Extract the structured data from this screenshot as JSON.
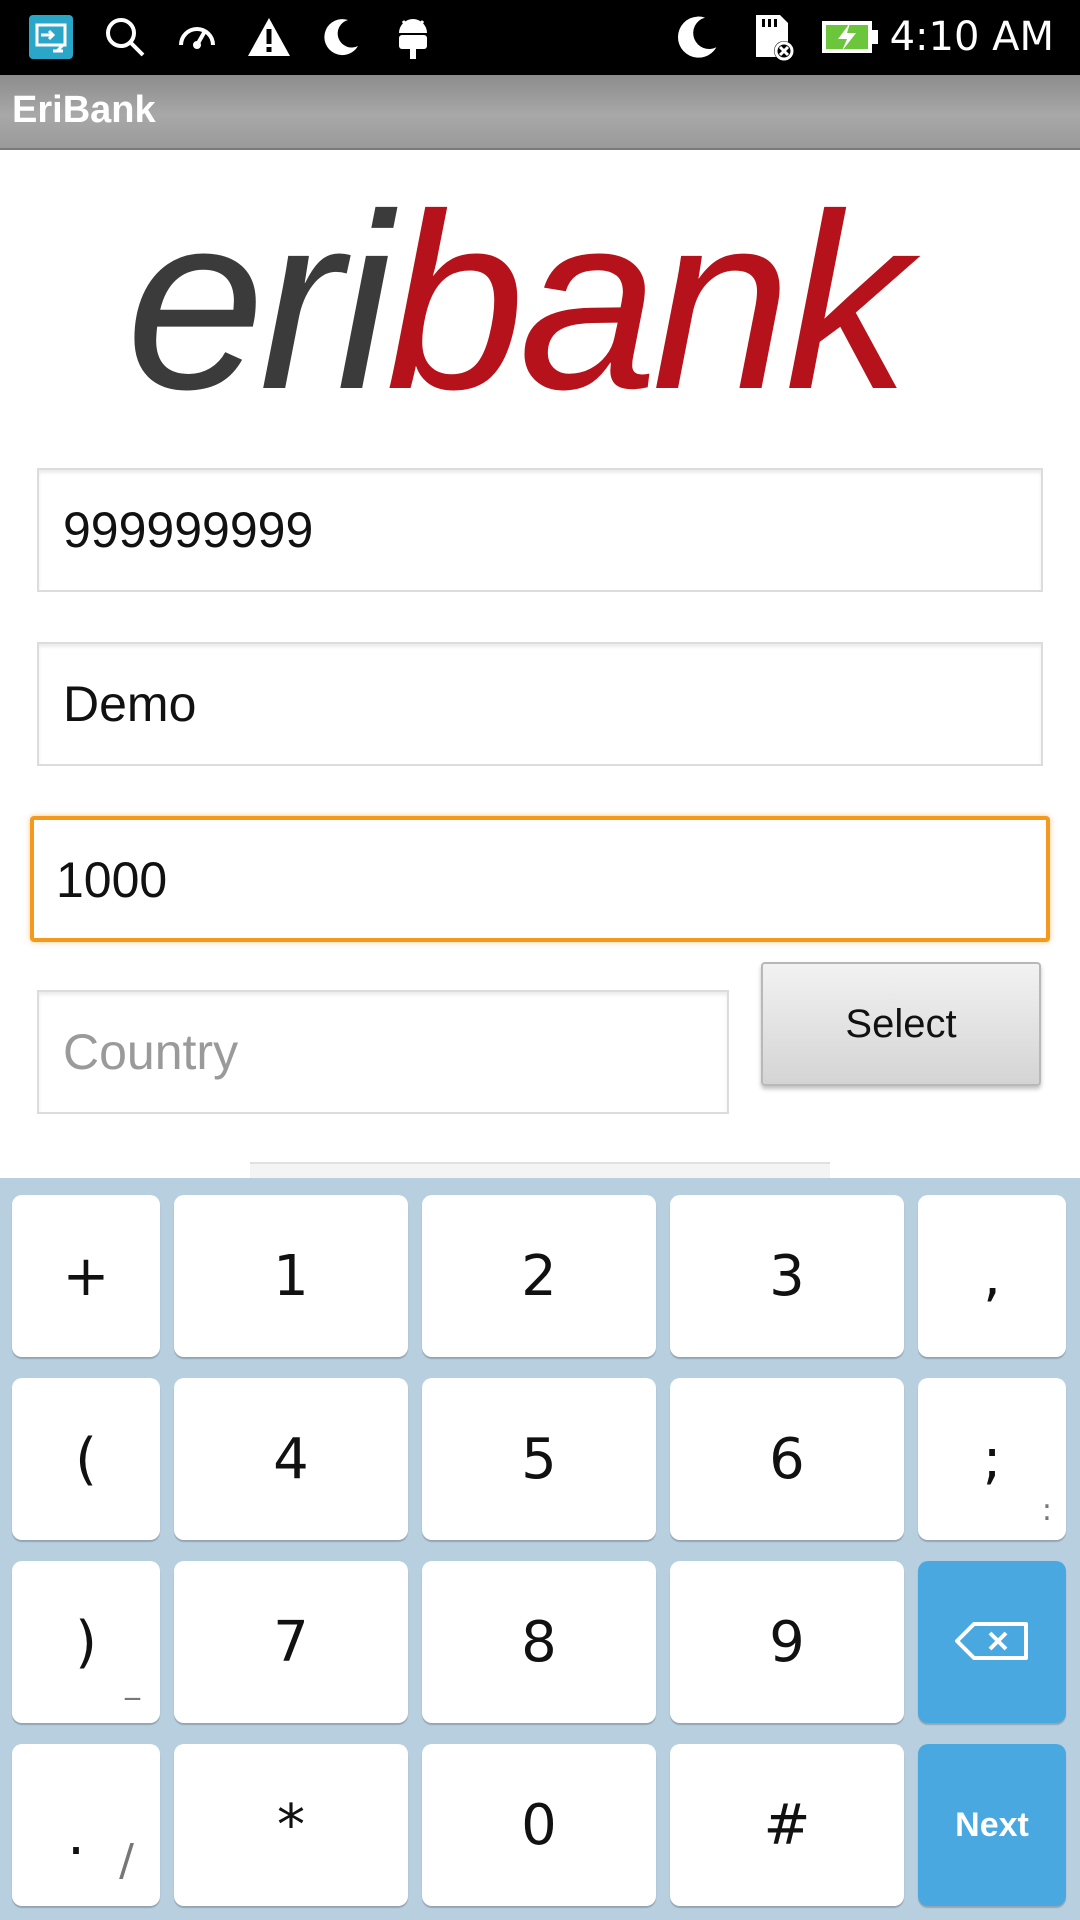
{
  "status_bar": {
    "time": "4:10 AM",
    "left_icons": [
      "screen-mirror-icon",
      "search-icon",
      "speed-icon",
      "warning-icon",
      "moon-icon",
      "android-debug-icon"
    ],
    "right_icons": [
      "moon-icon",
      "sd-card-error-icon",
      "battery-charging-icon"
    ]
  },
  "action_bar": {
    "title": "EriBank"
  },
  "logo": {
    "text_dark": "eri",
    "text_red": "bank",
    "color_dark": "#3b3b3b",
    "color_red": "#b5121b"
  },
  "form": {
    "phone_value": "999999999",
    "name_value": "Demo",
    "amount_value": "1000",
    "country_placeholder": "Country",
    "select_label": "Select"
  },
  "keyboard": {
    "rows": [
      [
        {
          "label": "+"
        },
        {
          "label": "1"
        },
        {
          "label": "2"
        },
        {
          "label": "3"
        },
        {
          "label": ","
        }
      ],
      [
        {
          "label": "("
        },
        {
          "label": "4"
        },
        {
          "label": "5"
        },
        {
          "label": "6"
        },
        {
          "label": ";",
          "hint": ":"
        }
      ],
      [
        {
          "label": ")",
          "hint": "_"
        },
        {
          "label": "7"
        },
        {
          "label": "8"
        },
        {
          "label": "9"
        },
        {
          "label": "",
          "icon": "backspace-icon"
        }
      ],
      [
        {
          "label": ".",
          "hint": "/"
        },
        {
          "label": "*"
        },
        {
          "label": "0"
        },
        {
          "label": "#"
        },
        {
          "label": "Next"
        }
      ]
    ]
  },
  "colors": {
    "focus_border": "#f39a1e",
    "key_blue": "#4aa8e0",
    "keyboard_bg": "#b8cfdf"
  }
}
